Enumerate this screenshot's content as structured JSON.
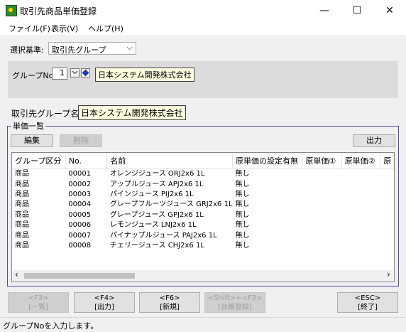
{
  "window": {
    "title": "取引先商品単価登録",
    "minimize": "—",
    "maximize": "☐",
    "close": "✕"
  },
  "menu": [
    "ファイル(F)",
    "表示(V)",
    "ヘルプ(H)"
  ],
  "selection": {
    "label": "選択基準:",
    "value": "取引先グループ",
    "chevron": "⌵"
  },
  "group": {
    "label": "グループNo.",
    "number": "1",
    "name": "日本システム開発株式会社"
  },
  "partner_group": {
    "label": "取引先グループ名:",
    "value": "日本システム開発株式会社"
  },
  "list": {
    "title": "単価一覧",
    "edit": "編集",
    "delete": "削除",
    "output": "出力",
    "columns": [
      "グループ区分",
      "No.",
      "名前",
      "原単価の設定有無",
      "原単価①",
      "原単価②",
      "原"
    ],
    "rows": [
      [
        "商品",
        "00001",
        "オレンジジュース ORJ2x6 1L",
        "無し"
      ],
      [
        "商品",
        "00002",
        "アップルジュース APJ2x6 1L",
        "無し"
      ],
      [
        "商品",
        "00003",
        "パインジュース PIJ2x6 1L",
        "無し"
      ],
      [
        "商品",
        "00004",
        "グレープフルーツジュース GRJ2x6 1L",
        "無し"
      ],
      [
        "商品",
        "00005",
        "グレープジュース GPJ2x6 1L",
        "無し"
      ],
      [
        "商品",
        "00006",
        "レモンジュース LNJ2x6 1L",
        "無し"
      ],
      [
        "商品",
        "00007",
        "パイナップルジュース PAJ2x6 1L",
        "無し"
      ],
      [
        "商品",
        "00008",
        "チェリージュース CHJ2x6 1L",
        "無し"
      ]
    ],
    "scroll_left": "‹",
    "scroll_right": "›"
  },
  "fkeys": {
    "f3": {
      "key": "<F3>",
      "label": "[一覧]"
    },
    "f4": {
      "key": "<F4>",
      "label": "[出力]"
    },
    "f6": {
      "key": "<F6>",
      "label": "[新規]"
    },
    "shift_f3": {
      "key": "<Shift>+<F3>",
      "label": "[台帳登録]"
    },
    "esc": {
      "key": "<ESC>",
      "label": "[終了]"
    }
  },
  "status": "グループNoを入力します。"
}
